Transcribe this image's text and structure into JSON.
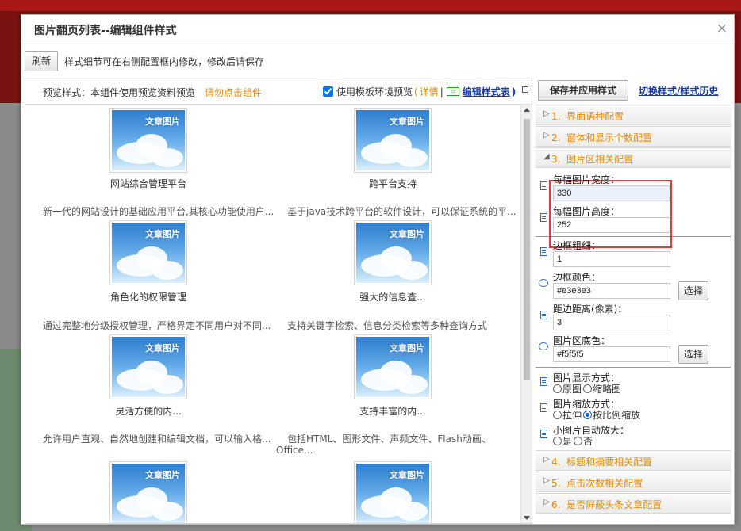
{
  "dialog": {
    "title": "图片翻页列表--编辑组件样式",
    "close_symbol": "×"
  },
  "toolbar": {
    "refresh_label": "刷新",
    "note": "样式细节可在右侧配置框内修改，修改后请保存"
  },
  "preview": {
    "style_note": "预览样式：本组件使用预览资料预览",
    "warn": "请勿点击组件",
    "use_template_label": "使用模板环境预览",
    "detail_prefix": "(",
    "detail_label": "详情",
    "sep": "|",
    "edit_style_label": "编辑样式表",
    "edit_style_suffix": ")",
    "thumb_text": "文章图片",
    "items": [
      {
        "caption": "网站综合管理平台",
        "desc": "新一代的网站设计的基础应用平台,其核心功能使用户..."
      },
      {
        "caption": "跨平台支持",
        "desc": "基于java技术跨平台的软件设计，可以保证系统的平..."
      },
      {
        "caption": "角色化的权限管理",
        "desc": "通过完整地分级授权管理，严格界定不同用户对不同..."
      },
      {
        "caption": "强大的信息查...",
        "desc": "支持关键字检索、信息分类检索等多种查询方式"
      },
      {
        "caption": "灵活方便的内...",
        "desc": "允许用户直观、自然地创建和编辑文档，可以输入格..."
      },
      {
        "caption": "支持丰富的内...",
        "desc": "包括HTML、图形文件、声频文件、Flash动画、",
        "desc2": "Office..."
      }
    ]
  },
  "config": {
    "save_label": "保存并应用样式",
    "switch_label": "切换样式/样式历史",
    "sections": [
      {
        "index": "1.",
        "title": "界面语种配置"
      },
      {
        "index": "2.",
        "title": "窗体和显示个数配置"
      },
      {
        "index": "3.",
        "title": "图片区相关配置"
      },
      {
        "index": "4.",
        "title": "标题和摘要相关配置"
      },
      {
        "index": "5.",
        "title": "点击次数相关配置"
      },
      {
        "index": "6.",
        "title": "是否屏蔽头条文章配置"
      }
    ],
    "fields": {
      "img_width_label": "每幅图片宽度：",
      "img_width_value": "330",
      "img_height_label": "每幅图片高度：",
      "img_height_value": "252",
      "border_width_label": "边框粗细：",
      "border_width_value": "1",
      "border_color_label": "边框颜色：",
      "border_color_value": "#e3e3e3",
      "padding_label": "距边距离(像素)：",
      "padding_value": "3",
      "bg_color_label": "图片区底色：",
      "bg_color_value": "#f5f5f5",
      "choose_label": "选择"
    },
    "radios": {
      "display_label": "图片显示方式：",
      "display_opt1": "原图",
      "display_opt2": "缩略图",
      "scale_label": "图片缩放方式：",
      "scale_opt1": "拉伸",
      "scale_opt2": "按比例缩放",
      "autozoom_label": "小图片自动放大：",
      "autozoom_opt1": "是",
      "autozoom_opt2": "否"
    }
  },
  "colors": {
    "accent_orange": "#e58a00",
    "link_blue": "#1a3ea8",
    "highlight_red": "#e63a3a"
  }
}
